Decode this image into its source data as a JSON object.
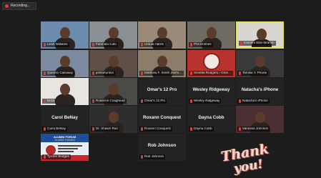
{
  "recording": {
    "label": "Recording..."
  },
  "participants": [
    {
      "name": "Leah Williams",
      "kind": "video",
      "bg": "#6b8cae"
    },
    {
      "name": "Fahmida Cato",
      "kind": "video",
      "bg": "#8a8f94"
    },
    {
      "name": "Ursula Harris",
      "kind": "video",
      "bg": "#9b8a77"
    },
    {
      "name": "Phil Holmes",
      "kind": "video",
      "bg": "#6f6a62"
    },
    {
      "name": "Kareem Ellis-Ibrahim",
      "kind": "video",
      "bg": "#d9d6cf",
      "active": true
    },
    {
      "name": "Quentin Callaway",
      "kind": "video",
      "bg": "#7d8aa0"
    },
    {
      "name": "joshahunton",
      "kind": "video",
      "bg": "#5e5048"
    },
    {
      "name": "Matthew F. Smith (he/him)",
      "kind": "video",
      "bg": "#8c7d6a"
    },
    {
      "name": "Sevetta Rodgers / Omega Psi Phi",
      "kind": "video",
      "bg": "#b8322e"
    },
    {
      "name": "Tamika Y. Phone",
      "kind": "video",
      "bg": "#3a3a3a"
    },
    {
      "name": "Erica",
      "kind": "video",
      "bg": "#e8e4df"
    },
    {
      "name": "Roderick Craighead",
      "kind": "video",
      "bg": "#4b4a46"
    },
    {
      "name": "Omar's 12 Pro",
      "kind": "name"
    },
    {
      "name": "Wesley Ridgeway",
      "kind": "name"
    },
    {
      "name": "Natacha's iPhone",
      "kind": "name"
    },
    {
      "name": "Carol BeNay",
      "kind": "name"
    },
    {
      "name": "Dr. Shawn Rao",
      "kind": "video",
      "bg": "#2e2e2e"
    },
    {
      "name": "Roxann Conquest",
      "kind": "name"
    },
    {
      "name": "Dayna Cobb",
      "kind": "name"
    },
    {
      "name": "Vanessa Johnson",
      "kind": "video",
      "bg": "#4a2f33"
    },
    {
      "name": "Tyrone Bridges",
      "kind": "video",
      "bg": "#e9eef3"
    },
    {
      "name": "Rob Johnson",
      "kind": "name"
    }
  ],
  "poster": {
    "title": "ALUMNI FORUM",
    "subtitle": "ALUMNI THANKS"
  },
  "thank_you": {
    "line1": "Thank",
    "line2": "you!"
  }
}
